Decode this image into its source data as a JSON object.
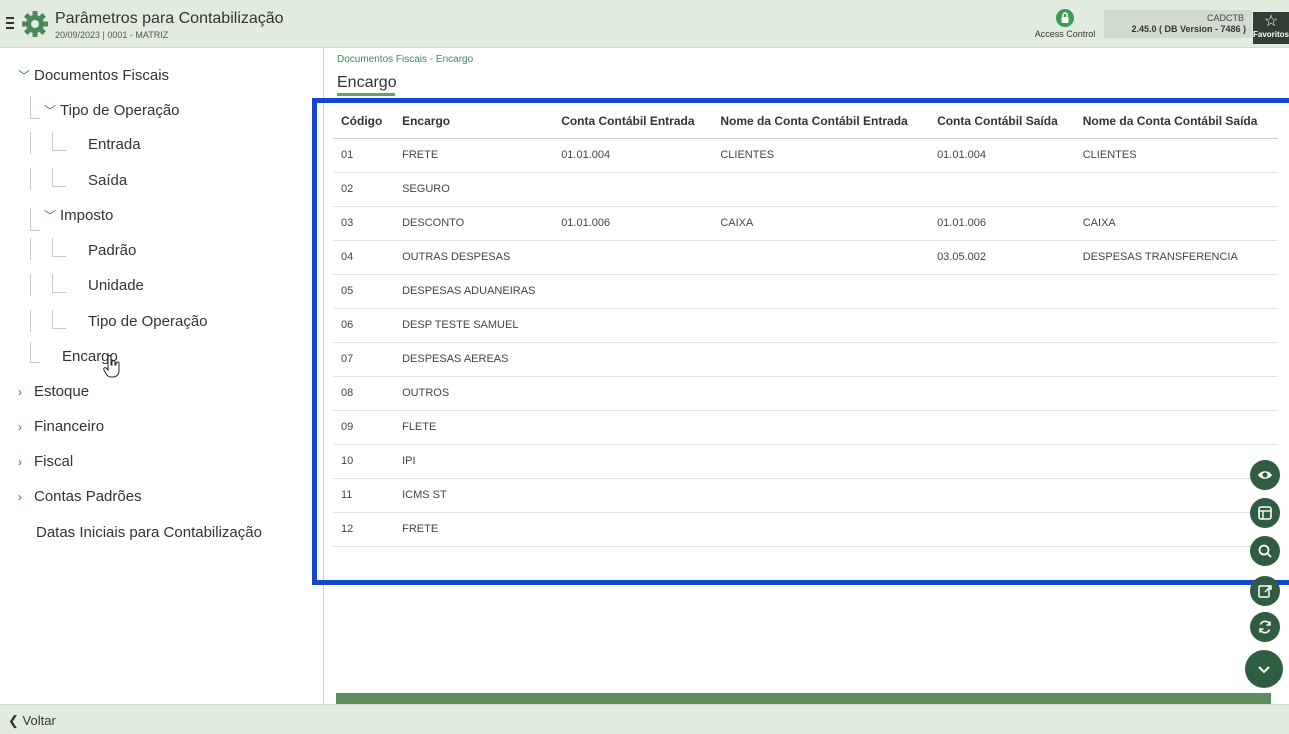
{
  "header": {
    "title": "Parâmetros para Contabilização",
    "subtitle": "20/09/2023 | 0001 - MATRIZ",
    "access_label": "Access Control",
    "version_code": "CADCTB",
    "version_text": "2.45.0 ( DB Version - 7486 )",
    "favorites_label": "Favoritos"
  },
  "sidebar": {
    "items": [
      {
        "label": "Documentos Fiscais",
        "expanded": true
      },
      {
        "label": "Tipo de Operação",
        "expanded": true
      },
      {
        "label": "Entrada"
      },
      {
        "label": "Saída"
      },
      {
        "label": "Imposto",
        "expanded": true
      },
      {
        "label": "Padrão"
      },
      {
        "label": "Unidade"
      },
      {
        "label": "Tipo de Operação"
      },
      {
        "label": "Encargo"
      },
      {
        "label": "Estoque",
        "expanded": false
      },
      {
        "label": "Financeiro",
        "expanded": false
      },
      {
        "label": "Fiscal",
        "expanded": false
      },
      {
        "label": "Contas Padrões",
        "expanded": false
      },
      {
        "label": "Datas Iniciais para Contabilização"
      }
    ]
  },
  "main": {
    "breadcrumb": "Documentos Fiscais - Encargo",
    "title": "Encargo",
    "table": {
      "columns": [
        "Código",
        "Encargo",
        "Conta Contábil Entrada",
        "Nome da Conta Contábil Entrada",
        "Conta Contábil Saída",
        "Nome da Conta Contábil Saída"
      ],
      "rows": [
        [
          "01",
          "FRETE",
          "01.01.004",
          "CLIENTES",
          "01.01.004",
          "CLIENTES"
        ],
        [
          "02",
          "SEGURO",
          "",
          "",
          "",
          ""
        ],
        [
          "03",
          "DESCONTO",
          "01.01.006",
          "CAIXA",
          "01.01.006",
          "CAIXA"
        ],
        [
          "04",
          "OUTRAS DESPESAS",
          "",
          "",
          "03.05.002",
          "DESPESAS TRANSFERENCIA"
        ],
        [
          "05",
          "DESPESAS ADUANEIRAS",
          "",
          "",
          "",
          ""
        ],
        [
          "06",
          "DESP TESTE SAMUEL",
          "",
          "",
          "",
          ""
        ],
        [
          "07",
          "DESPESAS AEREAS",
          "",
          "",
          "",
          ""
        ],
        [
          "08",
          "OUTROS",
          "",
          "",
          "",
          ""
        ],
        [
          "09",
          "FLETE",
          "",
          "",
          "",
          ""
        ],
        [
          "10",
          "IPI",
          "",
          "",
          "",
          ""
        ],
        [
          "11",
          "ICMS ST",
          "",
          "",
          "",
          ""
        ],
        [
          "12",
          "FRETE",
          "",
          "",
          "",
          ""
        ]
      ]
    }
  },
  "footer": {
    "back_label": "Voltar"
  },
  "colors": {
    "header_bg": "#e1ecdf",
    "accent_green": "#2f5d3f",
    "highlight_blue": "#1446d6"
  }
}
